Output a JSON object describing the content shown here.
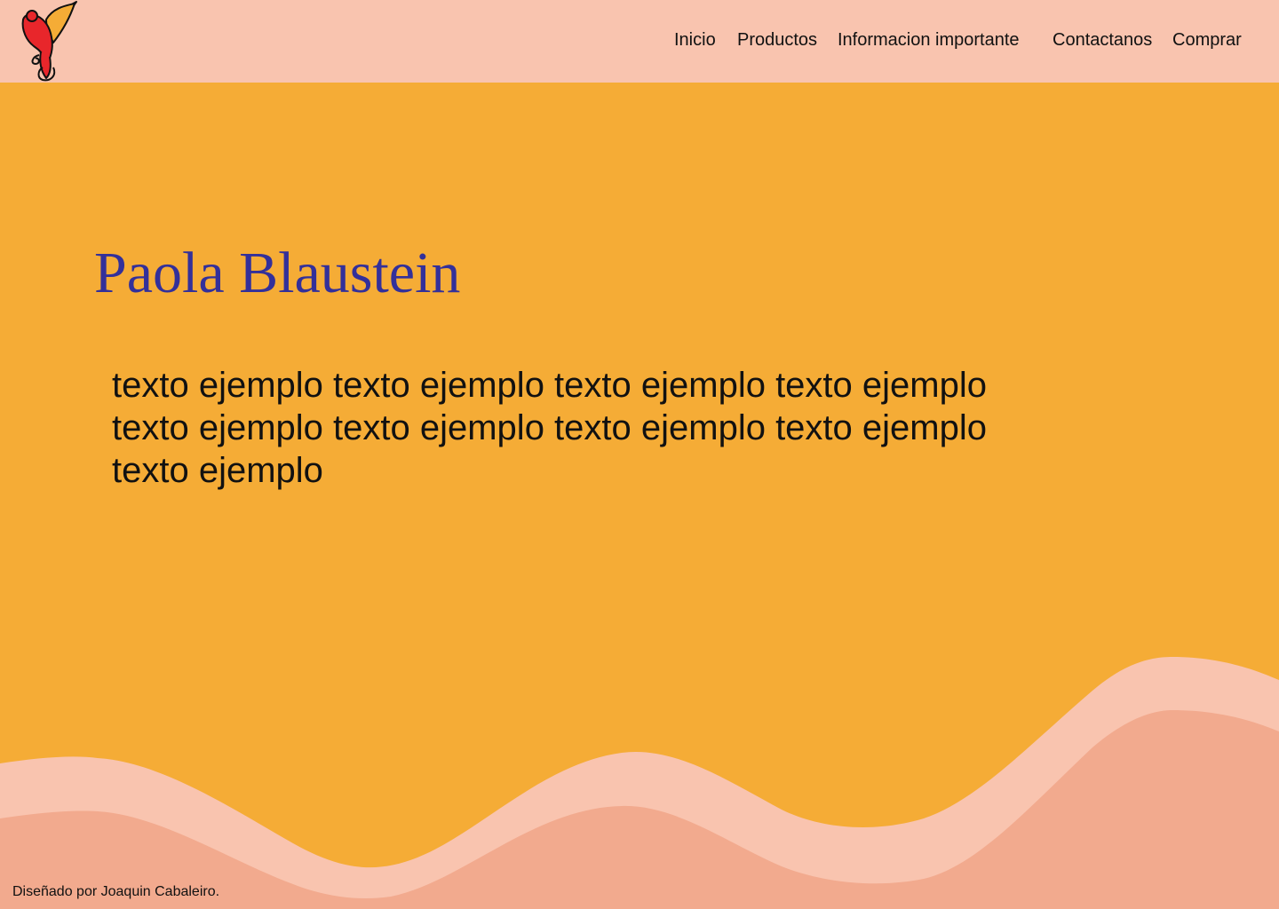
{
  "header": {
    "logo_icon": "hummingbird-logo-icon",
    "nav": [
      {
        "label": "Inicio"
      },
      {
        "label": "Productos"
      },
      {
        "label": "Informacion importante"
      },
      {
        "label": "Contactanos"
      },
      {
        "label": "Comprar"
      }
    ]
  },
  "hero": {
    "title": "Paola Blaustein",
    "text": "texto ejemplo texto ejemplo texto ejemplo texto ejemplo texto ejemplo texto ejemplo texto ejemplo texto ejemplo texto ejemplo"
  },
  "footer": {
    "credit": "Diseñado por Joaquin Cabaleiro."
  },
  "colors": {
    "header_bg": "#F9C4AF",
    "page_bg": "#F5AC36",
    "title": "#33309A",
    "wave_light": "#F9C4AF",
    "wave_dark": "#F2AA8E",
    "logo_red": "#E8262B",
    "logo_orange": "#F5AC36"
  }
}
